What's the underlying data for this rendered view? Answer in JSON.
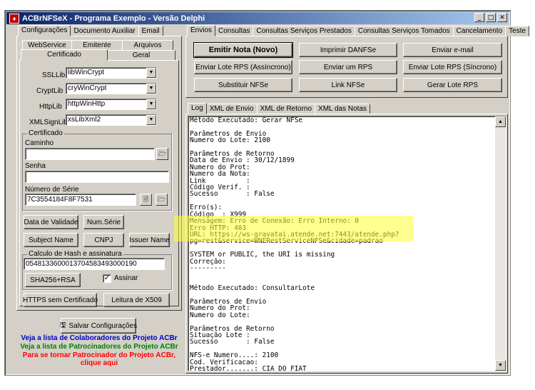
{
  "window": {
    "title": "ACBrNFSeX - Programa Exemplo - Versão Delphi"
  },
  "left": {
    "tabs": [
      "Configurações",
      "Documento Auxiliar",
      "Email"
    ],
    "subtabs_row1": [
      "WebService",
      "Emitente",
      "Arquivos"
    ],
    "subtabs_row2": [
      "Certificado",
      "Geral"
    ],
    "ssllib": {
      "label": "SSLLib",
      "value": "libWinCrypt"
    },
    "cryptlib": {
      "label": "CryptLib",
      "value": "cryWinCrypt"
    },
    "httplib": {
      "label": "HttpLib",
      "value": "httpWinHttp"
    },
    "xmlsignlib": {
      "label": "XMLSignLib",
      "value": "xsLibXml2"
    },
    "certificado": {
      "group": "Certificado",
      "caminho_label": "Caminho",
      "caminho_value": "",
      "senha_label": "Senha",
      "senha_value": "",
      "serie_label": "Número de Série",
      "serie_value": "7C3554184F8F7531"
    },
    "buttons": {
      "data_validade": "Data de Validade",
      "num_serie": "Num.Série",
      "subject_name": "Subject Name",
      "cnpj": "CNPJ",
      "issuer_name": "Issuer Name",
      "sha256": "SHA256+RSA",
      "https": "HTTPS sem Certificado",
      "leitura_x509": "Leitura de X509",
      "salvar": "Salvar Configurações"
    },
    "hash": {
      "group": "Calculo de Hash e assinatura",
      "value": "05481336000137045834930001​90",
      "assinar_label": "Assinar",
      "assinar_checked": true
    },
    "links": {
      "colaboradores": "Veja a lista de Colaboradores do Projeto ACBr",
      "patrocinadores": "Veja a lista de Patrocinadores do Projeto ACBr",
      "tornar1": "Para se tornar Patrocinador do Projeto ACBr,",
      "tornar2": "clique aqui",
      "color_colab": "#0000c0",
      "color_patroc": "#008000",
      "color_tornar": "#ff0000"
    }
  },
  "right": {
    "tabs": [
      "Envios",
      "Consultas",
      "Consultas Serviços Prestados",
      "Consultas Serviços Tomados",
      "Cancelamento",
      "Teste"
    ],
    "actions": [
      "Emitir Nota (Novo)",
      "Imprimir DANFSe",
      "Enviar e-mail",
      "Enviar Lote RPS (Assíncrono)",
      "Enviar um RPS",
      "Enviar Lote RPS (Síncrono)",
      "Substituir NFSe",
      "Link NFSe",
      "Gerar Lote RPS"
    ],
    "log_tabs": [
      "Log",
      "XML de Envio",
      "XML de Retorno",
      "XML das Notas"
    ],
    "log_text": "Método Executado: Gerar NFSe\n\nParâmetros de Envio\nNumero do Lote: 2100\n\nParâmetros de Retorno\nData de Envio : 30/12/1899\nNumero do Prot:\nNumero da Nota:\nLink          :\nCódigo Verif. :\nSucesso       : False\n\nErro(s):\nCódigo  : X999\nMensagem: Erro de Conexão: Erro Interno: 0\nErro HTTP: 403\nURL: https://ws-gravatai.atende.net:7443/atende.php?\npg=rest&service=WNERestServiceNFSe&cidade=padrao\n\nSYSTEM or PUBLIC, the URI is missing\nCorreção:\n---------\n\n\nMétodo Executado: ConsultarLote\n\nParâmetros de Envio\nNumero do Prot:\nNumero do Lote:\n\nParâmetros de Retorno\nSituação Lote :\nSucesso       : False\n\nNFS-e Numero....: 2100\nCod. Verificacao:\nPrestador.......: CIA DO FIAT\nTomador.........: INSCRICAO DE TESTE"
  }
}
